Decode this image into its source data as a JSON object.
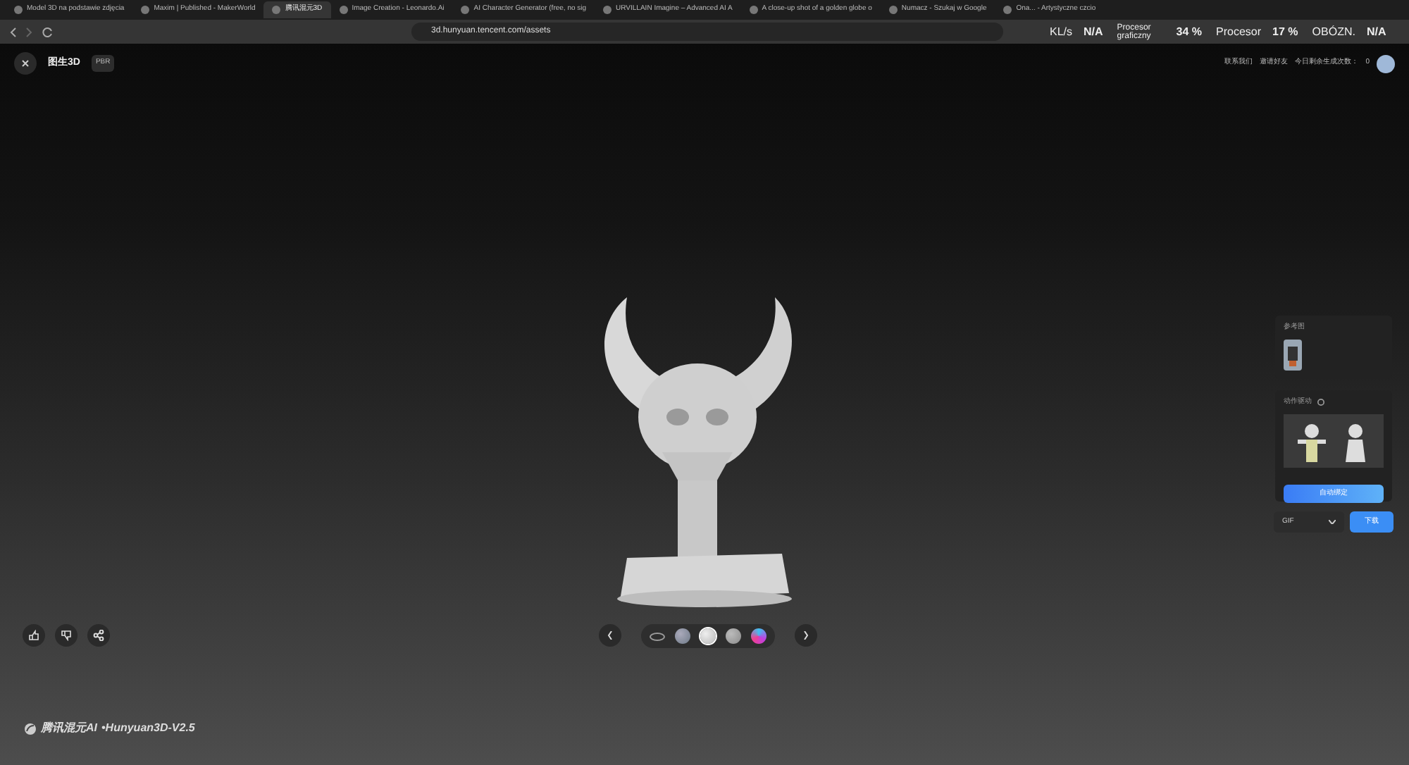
{
  "browser": {
    "tabs": [
      {
        "title": "Model 3D na podstawie zdjęcia",
        "selected": false
      },
      {
        "title": "Maxim | Published - MakerWorld",
        "selected": false
      },
      {
        "title": "腾讯混元3D",
        "selected": true
      },
      {
        "title": "Image Creation - Leonardo.Ai",
        "selected": false
      },
      {
        "title": "AI Character Generator (free, no sig",
        "selected": false
      },
      {
        "title": "URVILLAIN Imagine – Advanced AI A",
        "selected": false
      },
      {
        "title": "A close-up shot of a golden globe o",
        "selected": false
      },
      {
        "title": "Numacz - Szukaj w Google",
        "selected": false
      },
      {
        "title": "Ona... - Artystyczne czcio",
        "selected": false
      }
    ],
    "address": "3d.hunyuan.tencent.com/assets",
    "monitor": [
      {
        "label": "KL/s",
        "value": "N/A"
      },
      {
        "label": "Procesor graficzny",
        "value": "34 %"
      },
      {
        "label": "Procesor",
        "value": "17 %"
      },
      {
        "label": "OBÓZN.",
        "value": "N/A"
      }
    ]
  },
  "header": {
    "title": "图生3D",
    "badge": "PBR",
    "links": [
      "联系我们",
      "邀请好友"
    ],
    "quota_label": "今日剩余生成次数：",
    "quota_value": "0"
  },
  "panel": {
    "reference_label": "参考图",
    "motion_label": "动作驱动",
    "bind_button": "自动绑定",
    "format": "GIF",
    "download": "下载"
  },
  "materials": [
    {
      "kind": "outline",
      "selected": false
    },
    {
      "kind": "textured",
      "selected": false
    },
    {
      "kind": "white",
      "selected": true
    },
    {
      "kind": "grey",
      "selected": false
    },
    {
      "kind": "rainbow",
      "selected": false
    }
  ],
  "brand": {
    "name": "腾讯混元AI",
    "version": "•Hunyuan3D-V2.5"
  }
}
